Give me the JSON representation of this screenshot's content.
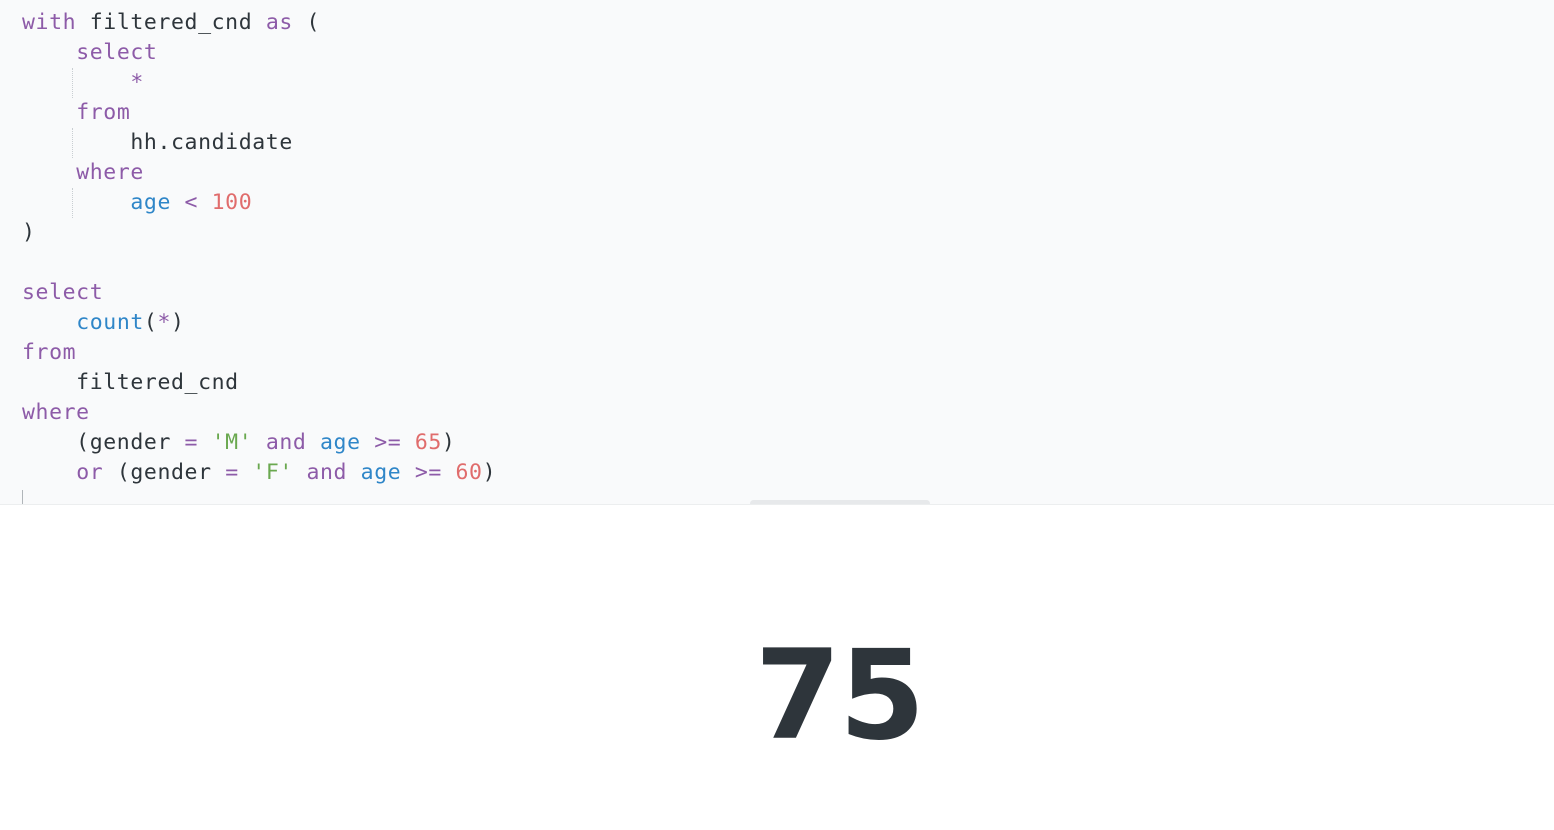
{
  "editor": {
    "lines": [
      [
        {
          "t": "with",
          "c": "kw"
        },
        {
          "t": " filtered_cnd ",
          "c": "plain"
        },
        {
          "t": "as",
          "c": "kw"
        },
        {
          "t": " (",
          "c": "plain"
        }
      ],
      [
        {
          "t": "    ",
          "c": "plain"
        },
        {
          "t": "select",
          "c": "kw"
        }
      ],
      [
        {
          "t": "        ",
          "c": "plain"
        },
        {
          "t": "*",
          "c": "kw"
        }
      ],
      [
        {
          "t": "    ",
          "c": "plain"
        },
        {
          "t": "from",
          "c": "kw"
        }
      ],
      [
        {
          "t": "        hh.candidate",
          "c": "plain"
        }
      ],
      [
        {
          "t": "    ",
          "c": "plain"
        },
        {
          "t": "where",
          "c": "kw"
        }
      ],
      [
        {
          "t": "        ",
          "c": "plain"
        },
        {
          "t": "age",
          "c": "fn"
        },
        {
          "t": " ",
          "c": "plain"
        },
        {
          "t": "<",
          "c": "op"
        },
        {
          "t": " ",
          "c": "plain"
        },
        {
          "t": "100",
          "c": "num"
        }
      ],
      [
        {
          "t": ")",
          "c": "plain"
        }
      ],
      [
        {
          "t": "",
          "c": "plain"
        }
      ],
      [
        {
          "t": "select",
          "c": "kw"
        }
      ],
      [
        {
          "t": "    ",
          "c": "plain"
        },
        {
          "t": "count",
          "c": "fn"
        },
        {
          "t": "(",
          "c": "plain"
        },
        {
          "t": "*",
          "c": "kw"
        },
        {
          "t": ")",
          "c": "plain"
        }
      ],
      [
        {
          "t": "from",
          "c": "kw"
        }
      ],
      [
        {
          "t": "    filtered_cnd",
          "c": "plain"
        }
      ],
      [
        {
          "t": "where",
          "c": "kw"
        }
      ],
      [
        {
          "t": "    (gender ",
          "c": "plain"
        },
        {
          "t": "=",
          "c": "op"
        },
        {
          "t": " ",
          "c": "plain"
        },
        {
          "t": "'M'",
          "c": "str"
        },
        {
          "t": " ",
          "c": "plain"
        },
        {
          "t": "and",
          "c": "kw"
        },
        {
          "t": " ",
          "c": "plain"
        },
        {
          "t": "age",
          "c": "fn"
        },
        {
          "t": " ",
          "c": "plain"
        },
        {
          "t": ">=",
          "c": "op"
        },
        {
          "t": " ",
          "c": "plain"
        },
        {
          "t": "65",
          "c": "num"
        },
        {
          "t": ")",
          "c": "plain"
        }
      ],
      [
        {
          "t": "    ",
          "c": "plain"
        },
        {
          "t": "or",
          "c": "kw"
        },
        {
          "t": " (gender ",
          "c": "plain"
        },
        {
          "t": "=",
          "c": "op"
        },
        {
          "t": " ",
          "c": "plain"
        },
        {
          "t": "'F'",
          "c": "str"
        },
        {
          "t": " ",
          "c": "plain"
        },
        {
          "t": "and",
          "c": "kw"
        },
        {
          "t": " ",
          "c": "plain"
        },
        {
          "t": "age",
          "c": "fn"
        },
        {
          "t": " ",
          "c": "plain"
        },
        {
          "t": ">=",
          "c": "op"
        },
        {
          "t": " ",
          "c": "plain"
        },
        {
          "t": "60",
          "c": "num"
        },
        {
          "t": ")",
          "c": "plain"
        }
      ]
    ]
  },
  "result": {
    "value": "75"
  },
  "colors": {
    "keyword": "#8d5ba8",
    "identifier": "#2f86c8",
    "number": "#e06c6c",
    "string": "#6aa84f",
    "text": "#2e353b",
    "editor_background": "#f9fafb"
  }
}
